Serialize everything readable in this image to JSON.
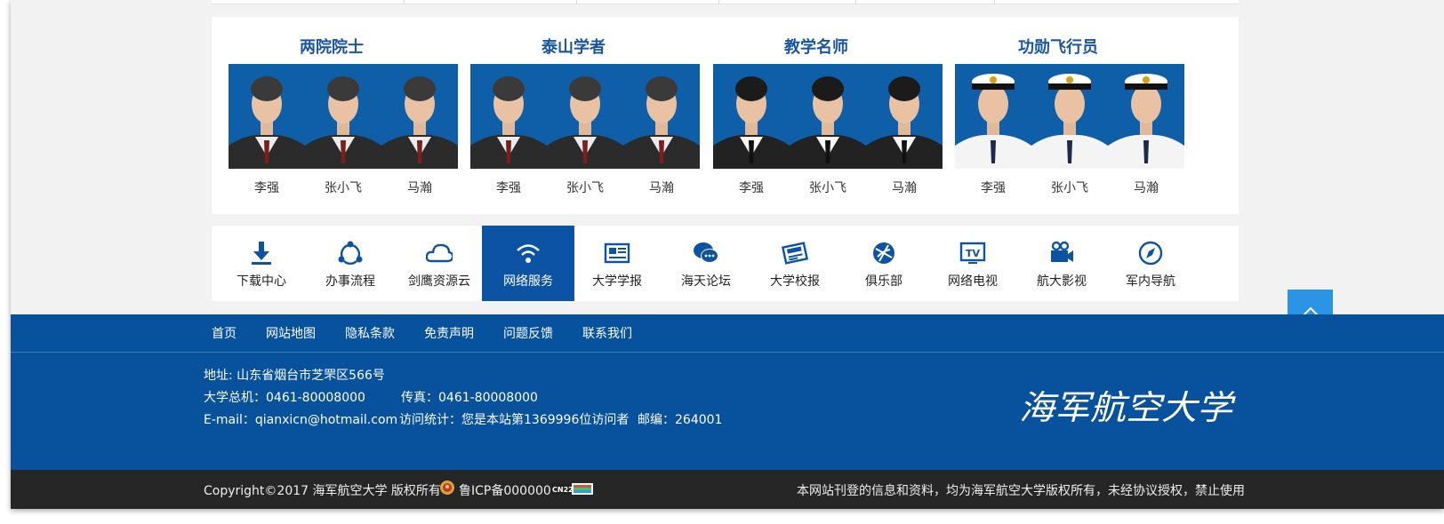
{
  "groups": [
    {
      "title": "两院院士",
      "people": [
        {
          "name": "李强"
        },
        {
          "name": "张小飞"
        },
        {
          "name": "马瀚"
        }
      ],
      "style": "formal"
    },
    {
      "title": "泰山学者",
      "people": [
        {
          "name": "李强"
        },
        {
          "name": "张小飞"
        },
        {
          "name": "马瀚"
        }
      ],
      "style": "formal"
    },
    {
      "title": "教学名师",
      "people": [
        {
          "name": "李强"
        },
        {
          "name": "张小飞"
        },
        {
          "name": "马瀚"
        }
      ],
      "style": "young"
    },
    {
      "title": "功勋飞行员",
      "people": [
        {
          "name": "李强"
        },
        {
          "name": "张小飞"
        },
        {
          "name": "马瀚"
        }
      ],
      "style": "navy"
    }
  ],
  "services": [
    {
      "label": "下载中心",
      "icon": "download-icon",
      "active": false
    },
    {
      "label": "办事流程",
      "icon": "workflow-icon",
      "active": false
    },
    {
      "label": "剑鹰资源云",
      "icon": "cloud-icon",
      "active": false
    },
    {
      "label": "网络服务",
      "icon": "wifi-icon",
      "active": true
    },
    {
      "label": "大学学报",
      "icon": "journal-icon",
      "active": false
    },
    {
      "label": "海天论坛",
      "icon": "chat-icon",
      "active": false
    },
    {
      "label": "大学校报",
      "icon": "newspaper-icon",
      "active": false
    },
    {
      "label": "俱乐部",
      "icon": "club-icon",
      "active": false
    },
    {
      "label": "网络电视",
      "icon": "tv-icon",
      "active": false
    },
    {
      "label": "航大影视",
      "icon": "video-camera-icon",
      "active": false
    },
    {
      "label": "军内导航",
      "icon": "compass-icon",
      "active": false
    }
  ],
  "footer": {
    "nav": [
      "首页",
      "网站地图",
      "隐私条款",
      "免责声明",
      "问题反馈",
      "联系我们"
    ],
    "address": "地址: 山东省烟台市芝罘区566号",
    "phone": "大学总机：0461-80008000",
    "fax": "传真：0461-80008000",
    "email": "E-mail：qianxicn@hotmail.com",
    "visits": "访问统计：您是本站第1369996位访问者",
    "postcode": "邮编：264001",
    "logo_text": "海军航空大学"
  },
  "bottom": {
    "copyright": "Copyright©2017 海军航空大学 版权所有",
    "icp": "鲁ICP备000000",
    "badge": "CN22",
    "notice": "本网站刊登的信息和资料，均为海军航空大学版权所有，未经协议授权，禁止使用"
  },
  "colors": {
    "brand_blue": "#07519d",
    "active_blue": "#0c54a3",
    "title_blue": "#1a56a3",
    "photo_bg": "#0f5ea8",
    "to_top": "#2b94e4",
    "dark_bar": "#262626"
  }
}
